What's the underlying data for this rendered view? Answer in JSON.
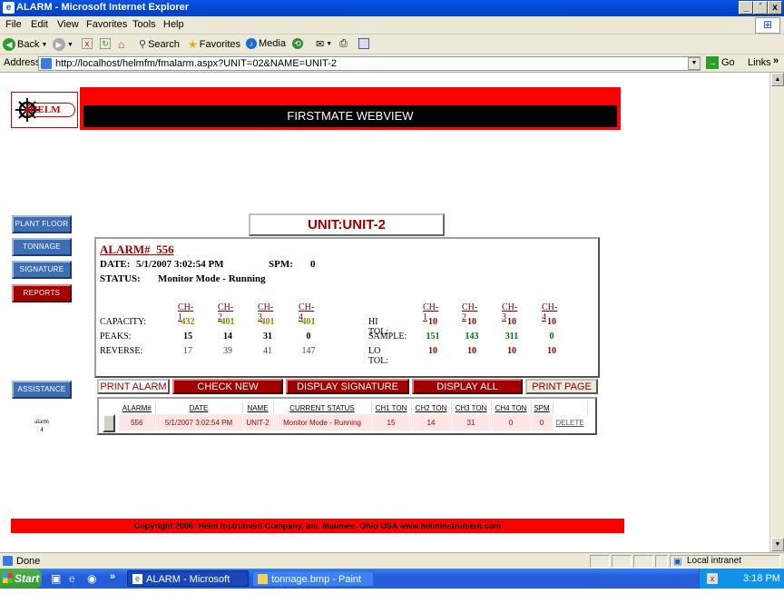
{
  "window": {
    "title": "ALARM - Microsoft Internet Explorer",
    "min": "_",
    "max": "´",
    "close": "x"
  },
  "menu": [
    "File",
    "Edit",
    "View",
    "Favorites",
    "Tools",
    "Help"
  ],
  "toolbar": {
    "back": "Back",
    "search": "Search",
    "favorites": "Favorites",
    "media": "Media"
  },
  "address": {
    "label": "Address",
    "url": "http://localhost/helmfm/fmalarm.aspx?UNIT=02&NAME=UNIT-2",
    "go": "Go",
    "links": "Links"
  },
  "banner": {
    "title": "FIRSTMATE WEBVIEW",
    "logo": "HELM"
  },
  "nav": {
    "plant_floor": "PLANT FLOOR",
    "tonnage": "TONNAGE",
    "signature": "SIGNATURE",
    "reports": "REPORTS",
    "assistance": "ASSISTANCE"
  },
  "alarm_count": {
    "label": "alarm",
    "value": "4"
  },
  "unit_title": "UNIT:UNIT-2",
  "alarm": {
    "number_label": "ALARM#",
    "number": "556",
    "date_label": "DATE:",
    "date": "5/1/2007 3:02:54 PM",
    "spm_label": "SPM:",
    "spm": "0",
    "status_label": "STATUS:",
    "status": "Monitor Mode - Running"
  },
  "left_grid": {
    "headers": [
      "CH-1",
      "CH-2",
      "CH-3",
      "CH-4"
    ],
    "capacity": {
      "label": "CAPACITY:",
      "values": [
        "432",
        "401",
        "401",
        "401"
      ]
    },
    "peaks": {
      "label": "PEAKS:",
      "values": [
        "15",
        "14",
        "31",
        "0"
      ]
    },
    "reverse": {
      "label": "REVERSE:",
      "values": [
        "17",
        "39",
        "41",
        "147"
      ]
    }
  },
  "right_grid": {
    "headers": [
      "CH-1",
      "CH-2",
      "CH-3",
      "CH-4"
    ],
    "hitol": {
      "label": "HI TOL:",
      "values": [
        "10",
        "10",
        "10",
        "10"
      ]
    },
    "sample": {
      "label": "SAMPLE:",
      "values": [
        "151",
        "143",
        "311",
        "0"
      ]
    },
    "lotol": {
      "label": "LO TOL:",
      "values": [
        "10",
        "10",
        "10",
        "10"
      ]
    }
  },
  "buttons": {
    "print_alarm": "PRINT ALARM",
    "check_new": "CHECK NEW",
    "display_signature": "DISPLAY SIGNATURE",
    "display_all": "DISPLAY ALL",
    "print_page": "PRINT PAGE"
  },
  "table": {
    "headers": [
      "ALARM#",
      "DATE",
      "NAME",
      "CURRENT STATUS",
      "CH1 TON",
      "CH2 TON",
      "CH3 TON",
      "CH4 TON",
      "SPM",
      ""
    ],
    "row": [
      "556",
      "5/1/2007 3:02:54 PM",
      "UNIT-2",
      "Monitor Mode - Running",
      "15",
      "14",
      "31",
      "0",
      "0",
      "DELETE"
    ]
  },
  "footer": "Copyright 2006: Helm Instrument Company, Inc.   Maumee, Ohio USA   www.helminstrument.com",
  "status": {
    "text": "Done",
    "zone": "Local intranet"
  },
  "taskbar": {
    "start": "Start",
    "task1": "ALARM - Microsoft In...",
    "task2": "tonnage.bmp - Paint",
    "clock": "3:18 PM",
    "more": "»"
  }
}
